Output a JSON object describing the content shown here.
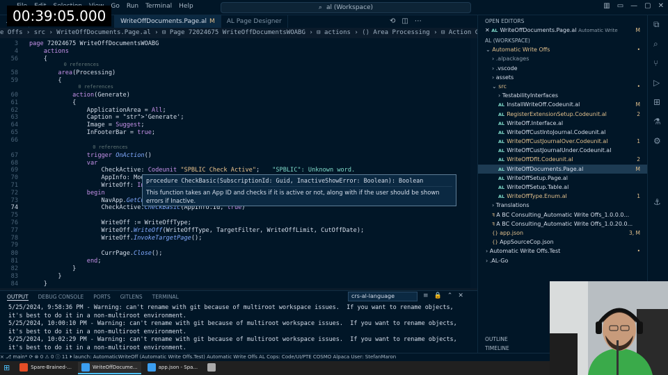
{
  "timer": "00:39:05.000",
  "menu": [
    "File",
    "Edit",
    "Selection",
    "View",
    "Go",
    "Run",
    "Terminal",
    "Help"
  ],
  "command_center": "al (Workspace)",
  "tabs": [
    {
      "label": "...al 1"
    },
    {
      "label": "WriteOffType.Enum.al 1",
      "color": "#e2c08d"
    },
    {
      "label": "WriteOffDocuments.Page.al",
      "badge": "M",
      "active": true
    },
    {
      "label": "AL Page Designer"
    }
  ],
  "breadcrumb": "e Offs › src › WriteOffDocuments.Page.al › ⊟ Page 72024675 WriteOffDocumentsWOABG › ⊟ actions › ⟨⟩ Area Processing › ⊟ Action Generate › ⊟ OnAction()",
  "code": [
    {
      "n": "3",
      "t": "page 72024675 WriteOffDocumentsWOABG"
    },
    {
      "n": "4",
      "t": "    actions"
    },
    {
      "n": "56",
      "t": "    {"
    },
    {
      "n": "58",
      "t": "        area(Processing)",
      "lens": "0 references"
    },
    {
      "n": "59",
      "t": "        {"
    },
    {
      "n": "60",
      "t": "            action(Generate)",
      "lens": "0 references"
    },
    {
      "n": "61",
      "t": "            {"
    },
    {
      "n": "62",
      "t": "                ApplicationArea = All;"
    },
    {
      "n": "63",
      "t": "                Caption = 'Generate';"
    },
    {
      "n": "64",
      "t": "                Image = Suggest;"
    },
    {
      "n": "65",
      "t": "                InFooterBar = true;"
    },
    {
      "n": "66",
      "t": ""
    },
    {
      "n": "67",
      "t": "                trigger OnAction()",
      "lens": "0 references"
    },
    {
      "n": "68",
      "t": "                var"
    },
    {
      "n": "69",
      "t": "                    CheckActive: Codeunit \"SPBLIC Check Active\";",
      "warn": "\"SPBLIC\": Unknown word."
    },
    {
      "n": "70",
      "t": "                    AppInfo: ModuleInfo;"
    },
    {
      "n": "71",
      "t": "                    WriteOff: Interface \"WriteOff\";"
    },
    {
      "n": "72",
      "t": "                begin"
    },
    {
      "n": "73",
      "t": "                    NavApp.GetCurrentModuleInfo(AppInfo);"
    },
    {
      "n": "74",
      "t": "                    CheckActive.CheckBasic(AppInfo.Id, true)"
    },
    {
      "n": "75",
      "t": ""
    },
    {
      "n": "76",
      "t": "                    WriteOff := WriteOffType;"
    },
    {
      "n": "77",
      "t": "                    WriteOff.WriteOff(WriteOffType, TargetFilter, WriteOffLimit, CutOffDate);"
    },
    {
      "n": "78",
      "t": "                    WriteOff.InvokeTargetPage();"
    },
    {
      "n": "79",
      "t": ""
    },
    {
      "n": "80",
      "t": "                    CurrPage.Close();"
    },
    {
      "n": "81",
      "t": "                end;"
    },
    {
      "n": "82",
      "t": "            }"
    },
    {
      "n": "83",
      "t": "        }"
    },
    {
      "n": "84",
      "t": "    }"
    }
  ],
  "hover": {
    "signature": "procedure CheckBasic(SubscriptionId: Guid, InactiveShowError: Boolean): Boolean",
    "doc": "This function takes an App ID and checks if it is active or not, along with if the user should be shown errors if Inactive."
  },
  "panel": {
    "tabs": [
      "OUTPUT",
      "DEBUG CONSOLE",
      "PORTS",
      "GITLENS",
      "TERMINAL"
    ],
    "channel": "crs-al-language",
    "lines": [
      "5/25/2024, 9:58:36 PM - Warning: can't rename with git because of multiroot workspace issues.  If you want to rename objects, it's best to do it in a non-multiroot environment.",
      "5/25/2024, 10:00:10 PM - Warning: can't rename with git because of multiroot workspace issues.  If you want to rename objects, it's best to do it in a non-multiroot environment.",
      "5/25/2024, 10:02:29 PM - Warning: can't rename with git because of multiroot workspace issues.  If you want to rename objects, it's best to do it in a non-multiroot environment."
    ]
  },
  "sidebar": {
    "open_editors": "OPEN EDITORS",
    "open_file": "WriteOffDocuments.Page.al",
    "open_file_desc": "Automatic Write",
    "open_badge": "M",
    "workspace": "AL (WORKSPACE)",
    "tree": [
      {
        "label": "Automatic Write Offs",
        "indent": 1,
        "chev": "⌄",
        "color": "y",
        "badge": "•"
      },
      {
        "label": ".alpackages",
        "indent": 2,
        "chev": "›",
        "color": "gray"
      },
      {
        "label": ".vscode",
        "indent": 2,
        "chev": "›"
      },
      {
        "label": "assets",
        "indent": 2,
        "chev": "›"
      },
      {
        "label": "src",
        "indent": 2,
        "chev": "⌄",
        "color": "y",
        "badge": "•"
      },
      {
        "label": "TestabilityInterfaces",
        "indent": 3,
        "chev": "›"
      },
      {
        "label": "InstallWriteOff.Codeunit.al",
        "indent": 3,
        "al": true,
        "badge": "M"
      },
      {
        "label": "RegisterExtensionSetup.Codeunit.al",
        "indent": 3,
        "al": true,
        "color": "y",
        "badge": "2"
      },
      {
        "label": "WriteOff.Interface.al",
        "indent": 3,
        "al": true
      },
      {
        "label": "WriteOffCustIntoJournal.Codeunit.al",
        "indent": 3,
        "al": true
      },
      {
        "label": "WriteOffCustJournalOver.Codeunit.al",
        "indent": 3,
        "al": true,
        "color": "y",
        "badge": "1"
      },
      {
        "label": "WriteOffCustJournalUnder.Codeunit.al",
        "indent": 3,
        "al": true
      },
      {
        "label": "WriteOffDflt.Codeunit.al",
        "indent": 3,
        "al": true,
        "color": "y",
        "badge": "2"
      },
      {
        "label": "WriteOffDocuments.Page.al",
        "indent": 3,
        "al": true,
        "badge": "M",
        "selected": true
      },
      {
        "label": "WriteOffSetup.Page.al",
        "indent": 3,
        "al": true
      },
      {
        "label": "WriteOffSetup.Table.al",
        "indent": 3,
        "al": true
      },
      {
        "label": "WriteOffType.Enum.al",
        "indent": 3,
        "al": true,
        "color": "y",
        "badge": "1"
      },
      {
        "label": "Translations",
        "indent": 2,
        "chev": "›"
      },
      {
        "label": "A BC Consulting_Automatic Write Offs_1.0.0.0...",
        "indent": 2,
        "ic": "ꟻ"
      },
      {
        "label": "A BC Consulting_Automatic Write Offs_1.0.20.0...",
        "indent": 2,
        "ic": "ꟻ"
      },
      {
        "label": "app.json",
        "indent": 2,
        "ic": "{}",
        "color": "y",
        "badge": "3, M"
      },
      {
        "label": "AppSourceCop.json",
        "indent": 2,
        "ic": "{}"
      },
      {
        "label": "Automatic Write Offs.Test",
        "indent": 1,
        "chev": "›",
        "badge": "•"
      },
      {
        "label": ".AL-Go",
        "indent": 1,
        "chev": "›"
      }
    ],
    "outline": "OUTLINE",
    "timeline": "TIMELINE"
  },
  "status": "⨯  ⎇ main*  ⟳  ⊗ 0 ⚠ 0  ⓘ 11   ⏵ launch: AutomaticWriteOff (Automatic Write Offs.Test)   Automatic Write Offs   AL Cops: Code/UI/PTE   COSMO Alpaca User: StefanMaron",
  "taskbar": [
    {
      "label": "Spare-Brained-...",
      "color": "#e44d26"
    },
    {
      "label": "WriteOffDocume...",
      "color": "#3b9ef0",
      "active": true
    },
    {
      "label": "app.json - Spa...",
      "color": "#3b9ef0"
    },
    {
      "label": "",
      "color": "#aaaaaa"
    }
  ]
}
